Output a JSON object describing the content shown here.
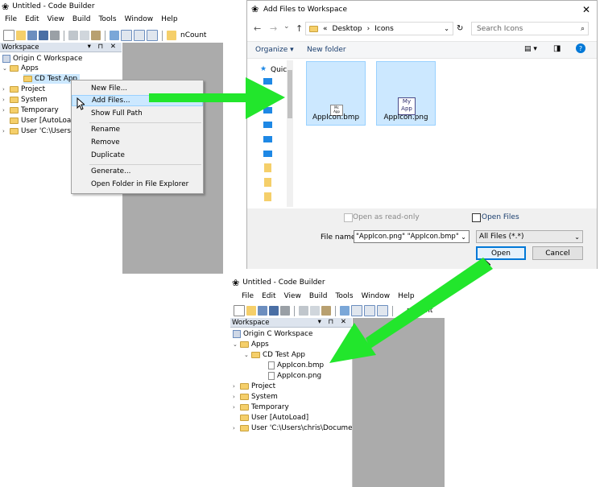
{
  "left_window": {
    "title": "Untitled - Code Builder",
    "menu": [
      "File",
      "Edit",
      "View",
      "Build",
      "Tools",
      "Window",
      "Help"
    ],
    "toolbar_text": "nCount",
    "workspace_header": "Workspace",
    "workspace_controls": "▾ ⊓ ✕",
    "tree": [
      {
        "label": "Origin C Workspace",
        "chevron": ""
      },
      {
        "label": "Apps",
        "chevron": "⌄"
      },
      {
        "label": "CD Test App",
        "chevron": ""
      },
      {
        "label": "Project",
        "chevron": "›"
      },
      {
        "label": "System",
        "chevron": "›"
      },
      {
        "label": "Temporary",
        "chevron": "›"
      },
      {
        "label": "User  [AutoLoad]",
        "chevron": ""
      },
      {
        "label": "User 'C:\\Users\\",
        "chevron": "›"
      }
    ]
  },
  "context_menu": {
    "items": [
      "New File...",
      "Add Files...",
      "Show Full Path",
      "Rename",
      "Remove",
      "Duplicate",
      "Generate...",
      "Open Folder in File Explorer"
    ],
    "highlighted": "Add Files..."
  },
  "dialog": {
    "title": "Add Files to Workspace",
    "close": "✕",
    "nav": {
      "back": "←",
      "forward": "→",
      "down": "⌄",
      "up": "↑"
    },
    "breadcrumb": {
      "prefix": "«",
      "parts": [
        "Desktop",
        "Icons"
      ],
      "sep": "›"
    },
    "search_placeholder": "Search Icons",
    "organize": "Organize ▾",
    "new_folder": "New folder",
    "quick_access": "Quic",
    "files": [
      "AppIcon.bmp",
      "AppIcon.png"
    ],
    "bmp_icon_text": "Mc App",
    "png_icon_text": "My App",
    "open_readonly": "Open as read-only",
    "open_files": "Open Files",
    "filename_label": "File name:",
    "filename_value": "\"AppIcon.png\" \"AppIcon.bmp\"",
    "filetype": "All Files (*.*)",
    "open_button": "Open",
    "cancel_button": "Cancel"
  },
  "bottom_window": {
    "title": "Untitled - Code Builder",
    "menu": [
      "File",
      "Edit",
      "View",
      "Build",
      "Tools",
      "Window",
      "Help"
    ],
    "toolbar_text": "nCount",
    "workspace_header": "Workspace",
    "workspace_controls": "▾ ⊓ ✕",
    "tree": [
      {
        "label": "Origin C Workspace",
        "chevron": ""
      },
      {
        "label": "Apps",
        "chevron": "⌄"
      },
      {
        "label": "CD Test App",
        "chevron": "⌄"
      },
      {
        "label": "AppIcon.bmp",
        "chevron": ""
      },
      {
        "label": "AppIcon.png",
        "chevron": ""
      },
      {
        "label": "Project",
        "chevron": "›"
      },
      {
        "label": "System",
        "chevron": "›"
      },
      {
        "label": "Temporary",
        "chevron": "›"
      },
      {
        "label": "User  [AutoLoad]",
        "chevron": ""
      },
      {
        "label": "User 'C:\\Users\\chris\\Documents",
        "chevron": "›"
      }
    ]
  },
  "colors": {
    "arrow": "#22e62c",
    "gray_area": "#ababab",
    "highlight": "#cce8ff",
    "accent": "#0078d7"
  }
}
